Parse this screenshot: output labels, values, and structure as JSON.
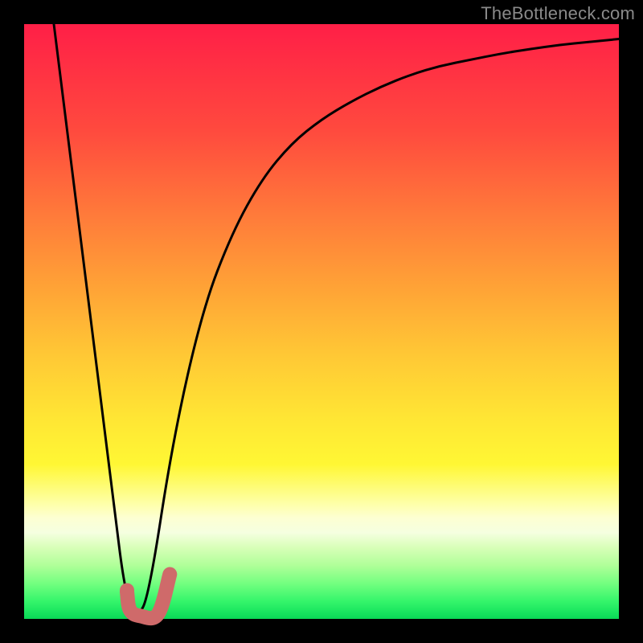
{
  "watermark": "TheBottleneck.com",
  "colors": {
    "frame": "#000000",
    "curve": "#000000",
    "marker": "#cf6a6a"
  },
  "chart_data": {
    "type": "line",
    "title": "",
    "xlabel": "",
    "ylabel": "",
    "xlim": [
      0,
      100
    ],
    "ylim": [
      0,
      100
    ],
    "grid": false,
    "legend": false,
    "background": "heat-gradient-red-to-green",
    "series": [
      {
        "name": "bottleneck-curve",
        "x": [
          5,
          10,
          15,
          17,
          19,
          21,
          25,
          30,
          35,
          40,
          45,
          50,
          55,
          60,
          65,
          70,
          75,
          80,
          85,
          90,
          95,
          100
        ],
        "values": [
          100,
          60,
          20,
          4,
          0,
          4,
          30,
          52,
          65,
          74,
          80,
          84,
          87,
          89.5,
          91.5,
          93,
          94,
          95,
          95.8,
          96.5,
          97,
          97.5
        ]
      }
    ],
    "marker": {
      "name": "J-marker",
      "points_xy": [
        [
          17.3,
          4.5
        ],
        [
          17.8,
          1.5
        ],
        [
          19.5,
          0.5
        ],
        [
          22.5,
          0.8
        ],
        [
          24.5,
          7.5
        ]
      ],
      "dot_xy": [
        17.3,
        4.8
      ]
    }
  }
}
